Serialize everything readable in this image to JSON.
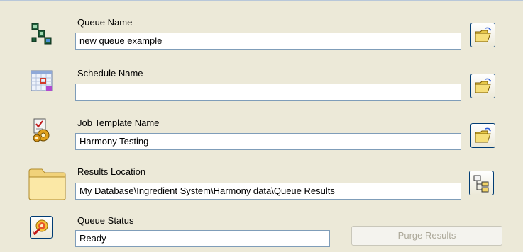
{
  "queue_name": {
    "label": "Queue Name",
    "value": "new queue example"
  },
  "schedule_name": {
    "label": "Schedule Name",
    "value": ""
  },
  "job_template_name": {
    "label": "Job Template Name",
    "value": "Harmony Testing"
  },
  "results_location": {
    "label": "Results Location",
    "value": "My Database\\Ingredient System\\Harmony data\\Queue Results"
  },
  "queue_status": {
    "label": "Queue Status",
    "value": "Ready"
  },
  "purge_button_label": "Purge Results",
  "colors": {
    "panel_bg": "#ece9d8",
    "field_border": "#7f9db9",
    "button_border": "#003c74",
    "disabled_text": "#aca899"
  },
  "icons": [
    "queue-icon",
    "schedule-calendar-icon",
    "job-template-icon",
    "folder-icon",
    "queue-status-target-icon",
    "open-folder-icon",
    "tree-structure-icon"
  ]
}
